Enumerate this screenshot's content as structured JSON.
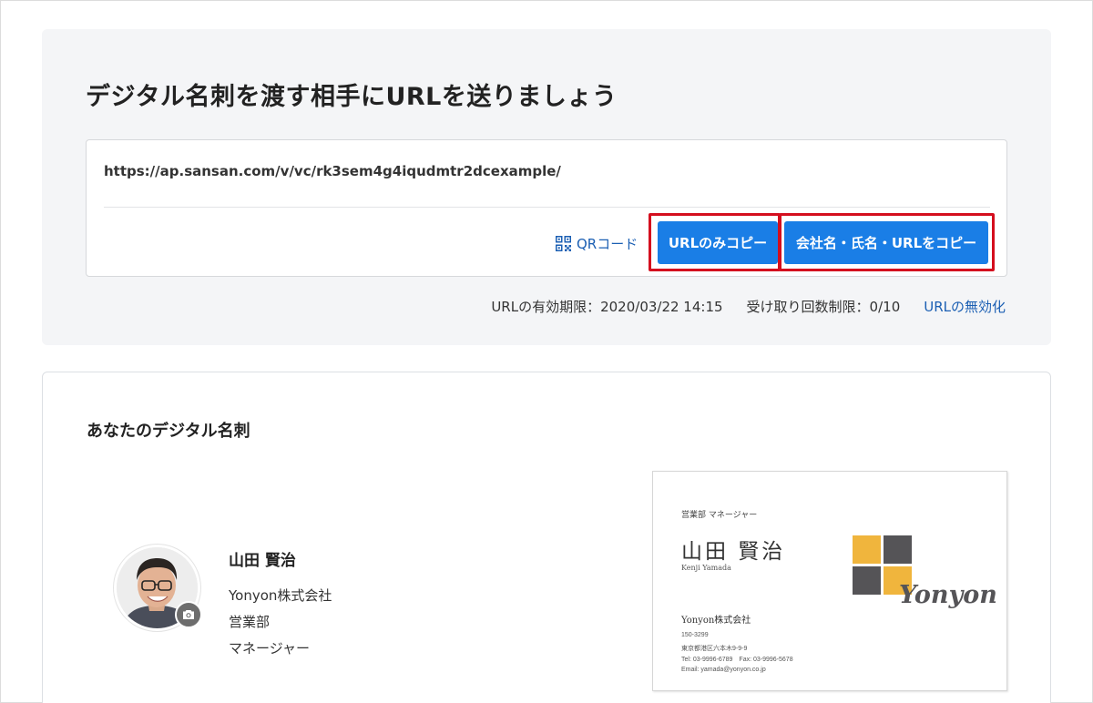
{
  "share": {
    "title": "デジタル名刺を渡す相手にURLを送りましょう",
    "url": "https://ap.sansan.com/v/vc/rk3sem4g4iqudmtr2dcexample/",
    "qr_label": "QRコード",
    "copy_url_label": "URLのみコピー",
    "copy_all_label": "会社名・氏名・URLをコピー",
    "expiry": "URLの有効期限：2020/03/22 14:15",
    "receive_limit": "受け取り回数制限：0/10",
    "disable_link": "URLの無効化"
  },
  "card_section": {
    "title": "あなたのデジタル名刺",
    "profile": {
      "name": "山田 賢治",
      "company": "Yonyon株式会社",
      "department": "営業部",
      "position": "マネージャー"
    },
    "business_card": {
      "dept_title": "営業部 マネージャー",
      "name": "山田 賢治",
      "romanized": "Kenji Yamada",
      "company": "Yonyon株式会社",
      "zip": "150-3299",
      "address": "東京都港区六本木9-9-9",
      "tel_fax": "Tel: 03-9996-6789　Fax: 03-9996-5678",
      "email": "Email: yamada@yonyon.co.jp",
      "logo_text": "Yonyon"
    }
  },
  "colors": {
    "primary_button": "#1a7ee6",
    "link": "#1b5fb3",
    "highlight": "#d40e1e",
    "logo_yellow": "#f0b53d",
    "logo_gray": "#555457"
  }
}
